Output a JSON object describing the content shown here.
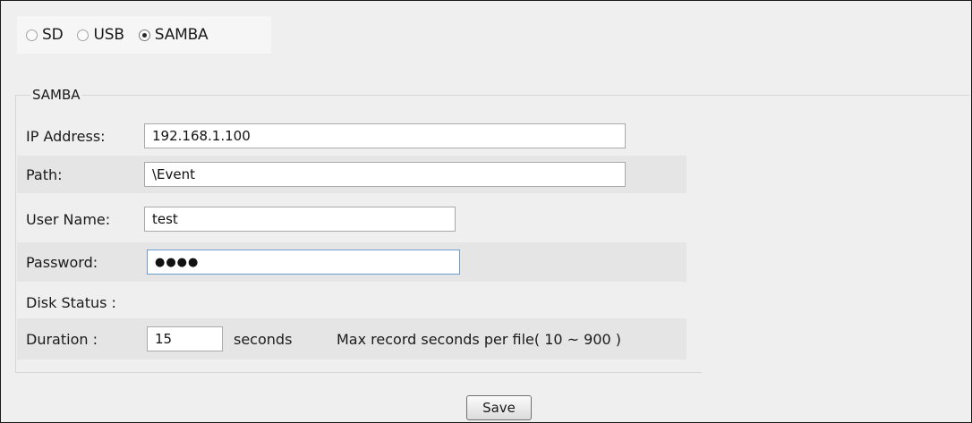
{
  "storage_type": {
    "options": [
      {
        "label": "SD",
        "selected": false
      },
      {
        "label": "USB",
        "selected": false
      },
      {
        "label": "SAMBA",
        "selected": true
      }
    ]
  },
  "samba": {
    "legend": "SAMBA",
    "ip_address": {
      "label": "IP Address:",
      "value": "192.168.1.100"
    },
    "path": {
      "label": "Path:",
      "value": "\\Event"
    },
    "user_name": {
      "label": "User Name:",
      "value": "test"
    },
    "password": {
      "label": "Password:",
      "value": "●●●●"
    },
    "disk_status": {
      "label": "Disk Status :",
      "value": ""
    },
    "duration": {
      "label": "Duration :",
      "value": "15",
      "unit": "seconds",
      "hint": "Max record seconds per file( 10 ~ 900 )"
    }
  },
  "actions": {
    "save_label": "Save"
  }
}
